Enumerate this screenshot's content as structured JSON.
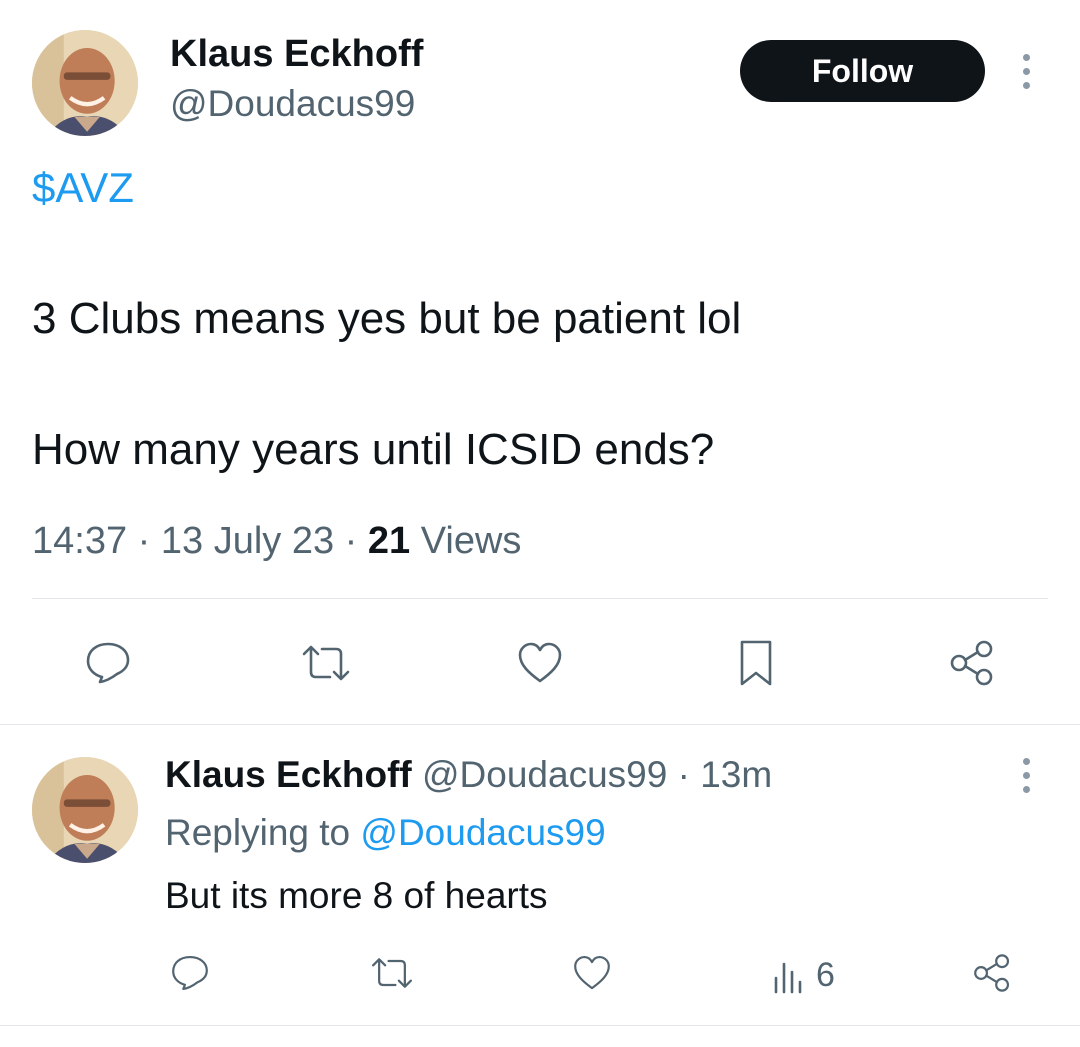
{
  "tweet": {
    "author": {
      "display_name": "Klaus Eckhoff",
      "handle": "@Doudacus99"
    },
    "follow_label": "Follow",
    "cashtag": "$AVZ",
    "line1": "3 Clubs means yes but be patient lol",
    "line2": "How many years until ICSID ends?",
    "meta": {
      "time": "14:37",
      "sep1": "·",
      "date": "13 July 23",
      "sep2": "·",
      "views_count": "21",
      "views_label": "Views"
    },
    "actions": [
      {
        "icon": "reply-icon"
      },
      {
        "icon": "retweet-icon"
      },
      {
        "icon": "like-icon"
      },
      {
        "icon": "bookmark-icon"
      },
      {
        "icon": "share-icon"
      }
    ]
  },
  "reply": {
    "author": {
      "display_name": "Klaus Eckhoff",
      "handle": "@Doudacus99",
      "sep": "·",
      "time_ago": "13m"
    },
    "replying_to_label": "Replying to",
    "replying_to_handle": "@Doudacus99",
    "text": "But its more 8 of hearts",
    "views_count": "6",
    "actions": [
      {
        "icon": "reply-icon"
      },
      {
        "icon": "retweet-icon"
      },
      {
        "icon": "like-icon"
      },
      {
        "icon": "views-icon"
      },
      {
        "icon": "share-icon"
      }
    ]
  },
  "colors": {
    "text": "#0f1419",
    "muted": "#536471",
    "link": "#1d9bf0",
    "follow_bg": "#0f1419",
    "divider": "#e4e7ea"
  }
}
